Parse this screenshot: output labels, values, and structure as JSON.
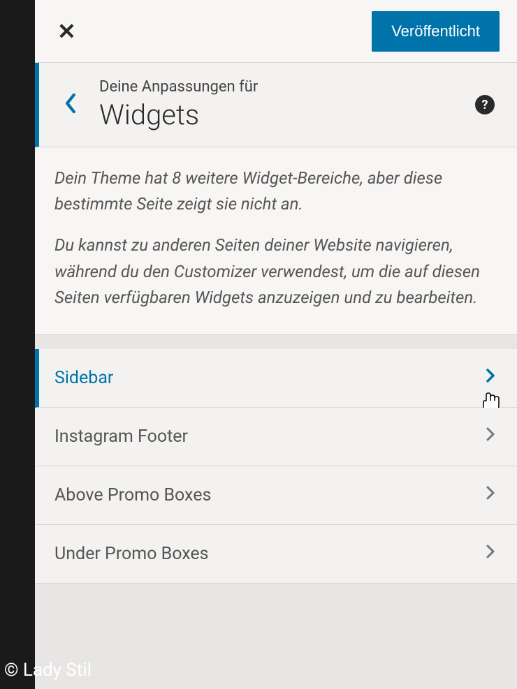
{
  "topbar": {
    "publish_label": "Veröffentlicht"
  },
  "header": {
    "subtitle": "Deine Anpassungen für",
    "title": "Widgets",
    "help": "?"
  },
  "description": {
    "para1": "Dein Theme hat 8 weitere Widget-Bereiche, aber diese bestimmte Seite zeigt sie nicht an.",
    "para2": "Du kannst zu anderen Seiten deiner Website navigieren, während du den Customizer verwendest, um die auf diesen Seiten verfügbaren Widgets anzuzeigen und zu bearbeiten."
  },
  "widgets": {
    "items": [
      {
        "label": "Sidebar",
        "active": true
      },
      {
        "label": "Instagram Footer",
        "active": false
      },
      {
        "label": "Above Promo Boxes",
        "active": false
      },
      {
        "label": "Under Promo Boxes",
        "active": false
      }
    ]
  },
  "watermark": "© Lady Stil"
}
